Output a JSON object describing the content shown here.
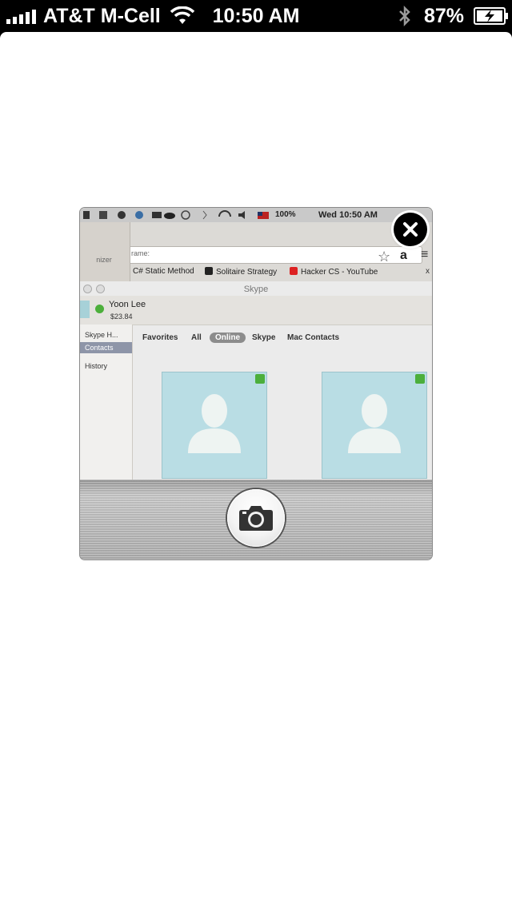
{
  "status_bar": {
    "carrier": "AT&T M-Cell",
    "time": "10:50 AM",
    "battery_percent": "87%",
    "icons": [
      "signal-icon",
      "wifi-icon",
      "bluetooth-icon",
      "battery-charging-icon"
    ]
  },
  "camera_preview": {
    "mac_menubar": {
      "battery": "100%",
      "clock": "Wed 10:50 AM"
    },
    "browser": {
      "left_panel_label": "nizer",
      "frame_label": "rame:",
      "bookmarks": [
        "C# Static Method",
        "Solitaire Strategy",
        "Hacker CS - YouTube"
      ],
      "amazon_glyph": "a",
      "close_glyph": "x"
    },
    "skype": {
      "window_title": "Skype",
      "profile_name": "Yoon Lee",
      "profile_credit": "$23.84",
      "sidebar_items": [
        "Skype H...",
        "Contacts",
        "History"
      ],
      "tabs": [
        "Favorites",
        "All",
        "Online",
        "Skype",
        "Mac Contacts"
      ],
      "active_tab": "Online"
    }
  },
  "controls": {
    "shutter_icon": "camera-icon",
    "close_icon": "close-icon"
  },
  "colors": {
    "status_bar_bg": "#000000",
    "sheet_bg": "#ffffff",
    "online_green": "#4caf3b",
    "avatar_blue": "#b9dde4"
  }
}
